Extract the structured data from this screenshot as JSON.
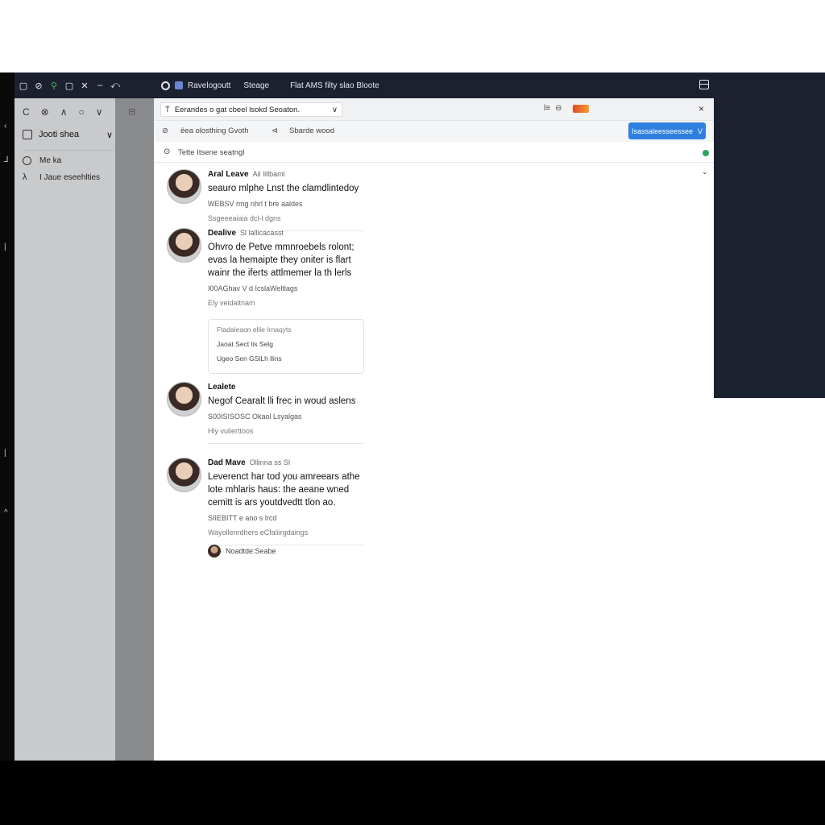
{
  "window": {
    "title": "Ravelogoutt",
    "menu_item": "Steage",
    "subtitle": "Flat AMS filty slao Bloote",
    "left_glyphs": [
      "▢",
      "▢",
      "⊘",
      "⚲",
      "▢",
      "✕",
      "–",
      "⤺"
    ],
    "edge_glyphs": [
      "‹",
      "⅃",
      "|",
      "|",
      "^"
    ]
  },
  "address_bar": {
    "prefix": "T̄",
    "text": "Eerandes o gat cbeel lsokd Seoaton.",
    "extra_icon_1": "l≡",
    "extra_icon_2": "⊖",
    "close": "×"
  },
  "toolbar": {
    "left_icon": "⊘",
    "text": "ëea olosthing Gvoth",
    "sep_icon": "⊲",
    "secondary_text": "Sbarde wood",
    "primary_button": "Isassaleesseessee",
    "primary_button_chevron": "V"
  },
  "filter": {
    "icon": "⊙",
    "text": "Tette Itsene seatngl"
  },
  "sidebar": {
    "top_icons": [
      "C",
      "⊗",
      "∧",
      "○",
      "∨"
    ],
    "section_label": "Jooti shea",
    "section_chevron": "∨",
    "items": [
      {
        "icon": "circle",
        "label": "Me ka"
      },
      {
        "icon": "λ",
        "label": "I Jaue eseehlties"
      }
    ],
    "mid_glyph": "⊟"
  },
  "posts": [
    {
      "author": "Aral Leave",
      "handle": "Ail lillbaml",
      "content": "seauro mlphe Lnst the clamdlintedoy",
      "meta": "WEBSV rmg nhrl t bre aaldes",
      "meta2": "Ssgeeeaiaia dcl-l dgns",
      "quote": null
    },
    {
      "author": "Dealive",
      "handle": "Sl lallicacasst",
      "content": "Ohvro de Petve mmnroebels rolont; evas la hemaipte they oniter is flart wainr the iferts attlmemer la th lerls",
      "meta": "I00AGhav V d IcslaWeltlags",
      "meta2": "Ely veidaltnam",
      "quote": {
        "head": "Ftadaleaon ellie Irnaqyts",
        "line1": "Jaoat Sect lis Selg",
        "line2": "Ugeo Sen GSlLh llins"
      }
    },
    {
      "author": "Lealete",
      "handle": "",
      "content": "Negof Cearalt lli frec in woud aslens",
      "meta": "S00ISISOSC Okaol Lsyalgas",
      "meta2": "Hly vulierttoos",
      "quote": null
    },
    {
      "author": "Dad Mave",
      "handle": "Ollinna ss SI",
      "content": "Leverenct har tod you amreears athe lote mhlaris haus: the aeane wned cemitt is ars youtdvedtt tlon ao.",
      "meta": "SIIEBITT e ano s lrcd",
      "meta2": "Wayollenrdhers eCfaliirgdaings",
      "quote": null
    }
  ],
  "footer": {
    "text": "Noadtde:Seabe"
  }
}
